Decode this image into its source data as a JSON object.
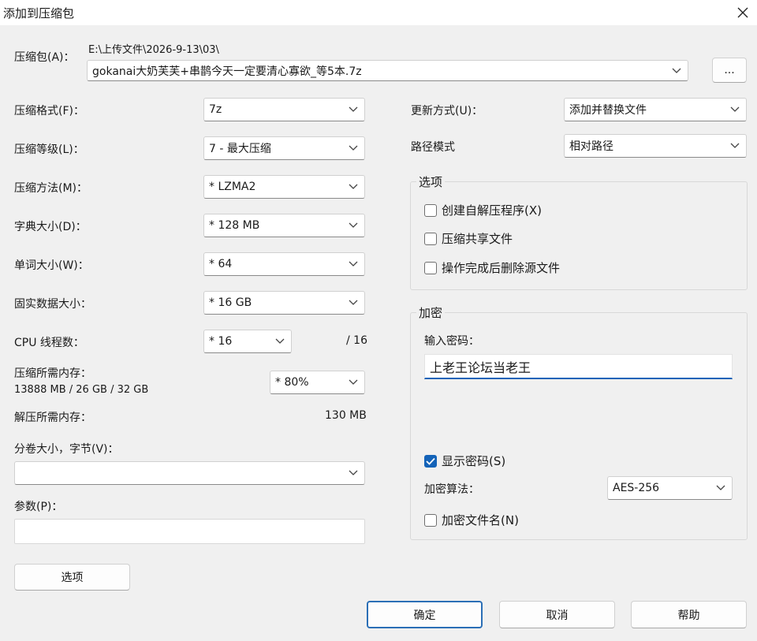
{
  "window": {
    "title": "添加到压缩包"
  },
  "archive": {
    "label": "压缩包(A)：",
    "path": "E:\\上传文件\\2026-9-13\\03\\",
    "filename": "gokanai大奶芙芙+串鹊今天一定要清心寡欲_等5本.7z",
    "browse_label": "..."
  },
  "left": {
    "format_label": "压缩格式(F)：",
    "format_value": "7z",
    "level_label": "压缩等级(L)：",
    "level_value": "7 - 最大压缩",
    "method_label": "压缩方法(M)：",
    "method_value": "* LZMA2",
    "dict_label": "字典大小(D)：",
    "dict_value": "* 128 MB",
    "word_label": "单词大小(W)：",
    "word_value": "* 64",
    "solid_label": "固实数据大小：",
    "solid_value": "* 16 GB",
    "threads_label": "CPU 线程数：",
    "threads_value": "* 16",
    "threads_total": "/ 16",
    "mem_label": "压缩所需内存：",
    "mem_detail": "13888 MB / 26 GB / 32 GB",
    "mem_value": "* 80%",
    "decomp_label": "解压所需内存：",
    "decomp_value": "130 MB",
    "split_label": "分卷大小，字节(V)：",
    "split_value": "",
    "params_label": "参数(P)：",
    "params_value": "",
    "options_button": "选项"
  },
  "right": {
    "update_label": "更新方式(U)：",
    "update_value": "添加并替换文件",
    "pathmode_label": "路径模式",
    "pathmode_value": "相对路径",
    "options_group": {
      "title": "选项",
      "sfx": "创建自解压程序(X)",
      "shared": "压缩共享文件",
      "delete": "操作完成后删除源文件"
    },
    "encryption": {
      "title": "加密",
      "password_label": "输入密码：",
      "password_value": "上老王论坛当老王",
      "show_password": "显示密码(S)",
      "show_password_checked": true,
      "method_label": "加密算法：",
      "method_value": "AES-256",
      "encrypt_names": "加密文件名(N)"
    }
  },
  "footer": {
    "ok": "确定",
    "cancel": "取消",
    "help": "帮助"
  },
  "icons": {
    "close": "close-icon",
    "chevron": "chevron-down-icon",
    "check": "checkmark-icon"
  },
  "colors": {
    "accent": "#1463b8",
    "background": "#f0f0f0"
  }
}
